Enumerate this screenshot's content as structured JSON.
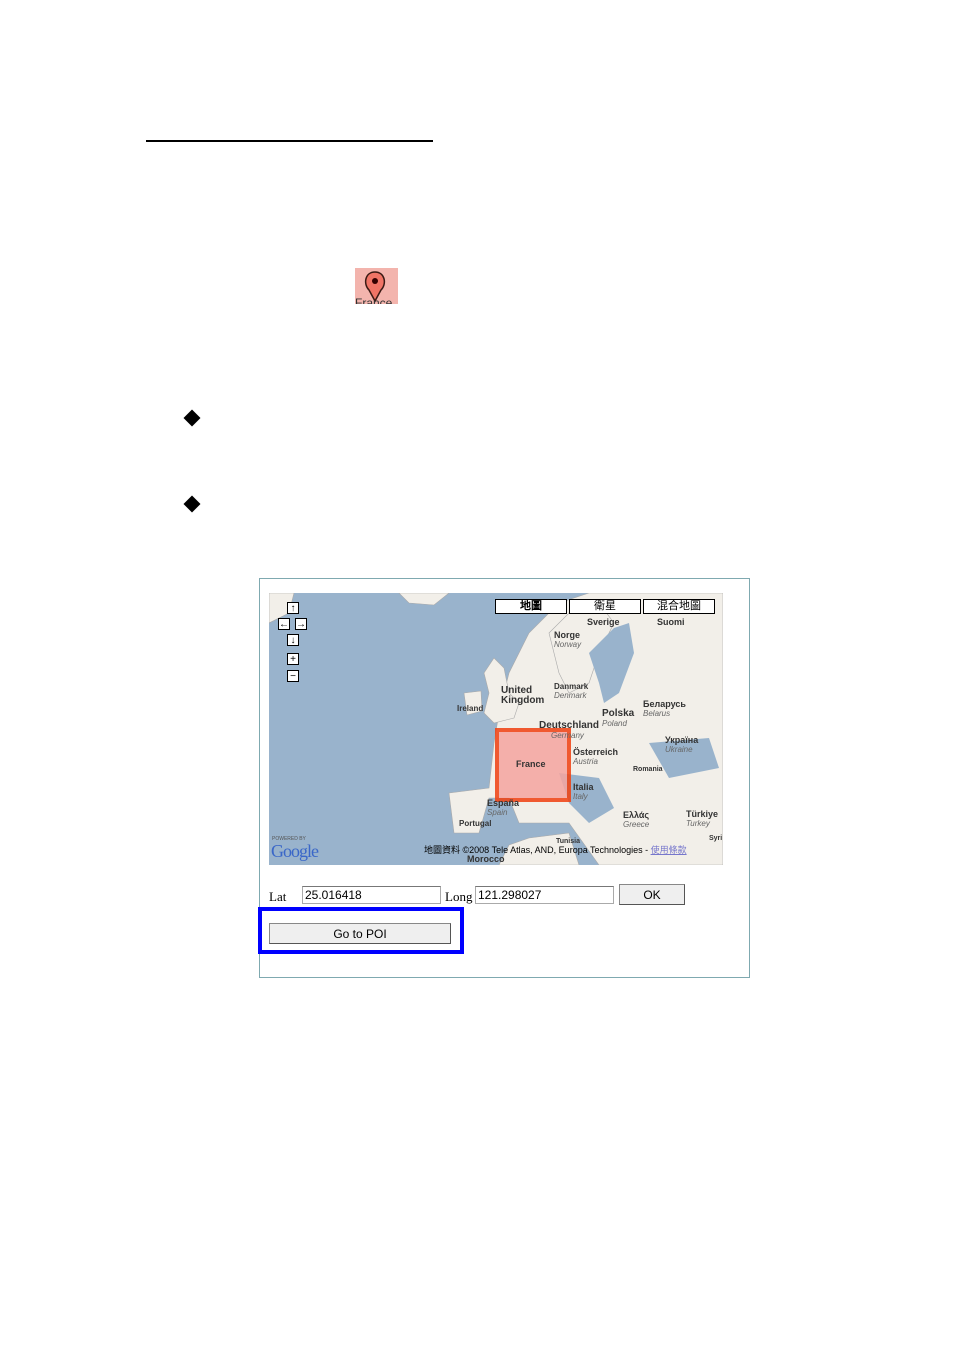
{
  "pin": {
    "label": "France"
  },
  "map": {
    "controls": {
      "pan_up": "↑",
      "pan_left": "←",
      "pan_right": "→",
      "pan_down": "↓",
      "zoom_in": "+",
      "zoom_out": "−"
    },
    "types": [
      "地圖",
      "衛星",
      "混合地圖"
    ],
    "labels": {
      "sverige": "Sverige",
      "suomi": "Suomi",
      "norge": "Norge",
      "norway": "Norway",
      "uk1": "United",
      "uk2": "Kingdom",
      "ireland": "Ireland",
      "danmark": "Danmark",
      "denmark": "Denmark",
      "belarus": "Беларусь",
      "belarus_en": "Belarus",
      "polska": "Polska",
      "poland": "Poland",
      "deutschland": "Deutschland",
      "germany": "Germany",
      "france": "France",
      "osterreich": "Österreich",
      "austria": "Austria",
      "ukraina": "Україна",
      "ukraine": "Ukraine",
      "romania": "Romania",
      "italia": "Italia",
      "italy": "Italy",
      "espana": "España",
      "spain": "Spain",
      "portugal": "Portugal",
      "ellas": "Ελλάς",
      "greece": "Greece",
      "turkiye": "Türkiye",
      "turkey": "Turkey",
      "tunisia": "Tunisia",
      "morocco": "Morocco",
      "syria": "Syri"
    },
    "powered_by": "POWERED BY",
    "logo": "Google",
    "copyright": "地圖資料 ©2008 Tele Atlas, AND, Europa Technologies - ",
    "terms_link": "使用條款",
    "highlight_color": "#f04010"
  },
  "form": {
    "lat_label": "Lat",
    "lat_value": "25.016418",
    "long_label": "Long",
    "long_value": "121.298027",
    "ok_label": "OK",
    "poi_button": "Go to POI",
    "poi_highlight_color": "#0000ff"
  }
}
